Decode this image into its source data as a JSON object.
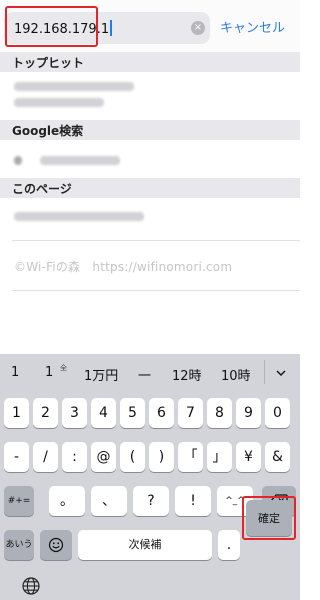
{
  "search": {
    "value": "192.168.179.1",
    "cancel_label": "キャンセル",
    "clear_icon": "×"
  },
  "sections": {
    "top_hits": "トップヒット",
    "google": "Google検索",
    "this_page": "このページ"
  },
  "watermark": "©Wi-Fiの森　https://wifinomori.com",
  "keyboard": {
    "candidates": [
      "1",
      "1",
      "1万円",
      "一",
      "12時",
      "10時"
    ],
    "candidate_superscript": "全",
    "row1": [
      "1",
      "2",
      "3",
      "4",
      "5",
      "6",
      "7",
      "8",
      "9",
      "0"
    ],
    "row2": [
      "-",
      "/",
      ":",
      "@",
      "(",
      ")",
      "「",
      "」",
      "¥",
      "&"
    ],
    "row3_left": "#+=",
    "row3": [
      "。",
      "、",
      "?",
      "!",
      "^_^"
    ],
    "bottom": {
      "mode_label": "あいう",
      "space_label": "次候補",
      "period_label": ".",
      "confirm_label": "確定"
    },
    "icons": {
      "delete": "delete-icon",
      "emoji": "emoji-icon",
      "globe": "globe-icon",
      "chevron": "chevron-down-icon"
    }
  },
  "colors": {
    "accent": "#2b7de8",
    "highlight": "#e1262b",
    "keyboard_bg": "#d2d4d9"
  }
}
